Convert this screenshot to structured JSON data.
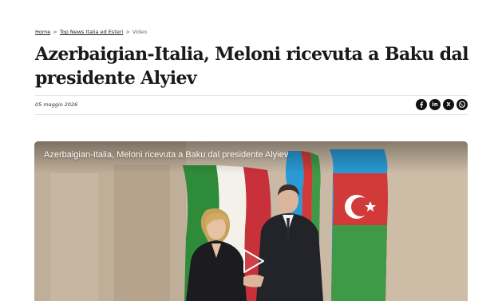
{
  "breadcrumb": {
    "home": "Home",
    "sep1": ">",
    "section": "Top News Italia ed Esteri",
    "sep2": ">",
    "current": "Video"
  },
  "article": {
    "title": "Azerbaigian-Italia, Meloni ricevuta a Baku dal presidente Alyiev",
    "date": "05 maggio 2026"
  },
  "share": {
    "facebook_icon": "facebook-icon",
    "linkedin_label": "in",
    "x_label": "X",
    "whatsapp_icon": "whatsapp-icon"
  },
  "video": {
    "title": "Azerbaigian-Italia, Meloni ricevuta a Baku dal presidente Alyiev",
    "play_icon": "play-icon"
  },
  "colors": {
    "share_button_bg": "#111111",
    "title_text": "#1a1a1a",
    "flag_italy_green": "#2e8b3a",
    "flag_italy_red": "#c8303a",
    "flag_azerbaijan_blue": "#2a9ad6",
    "flag_azerbaijan_red": "#d23a3a",
    "flag_azerbaijan_green": "#3f9a48"
  }
}
